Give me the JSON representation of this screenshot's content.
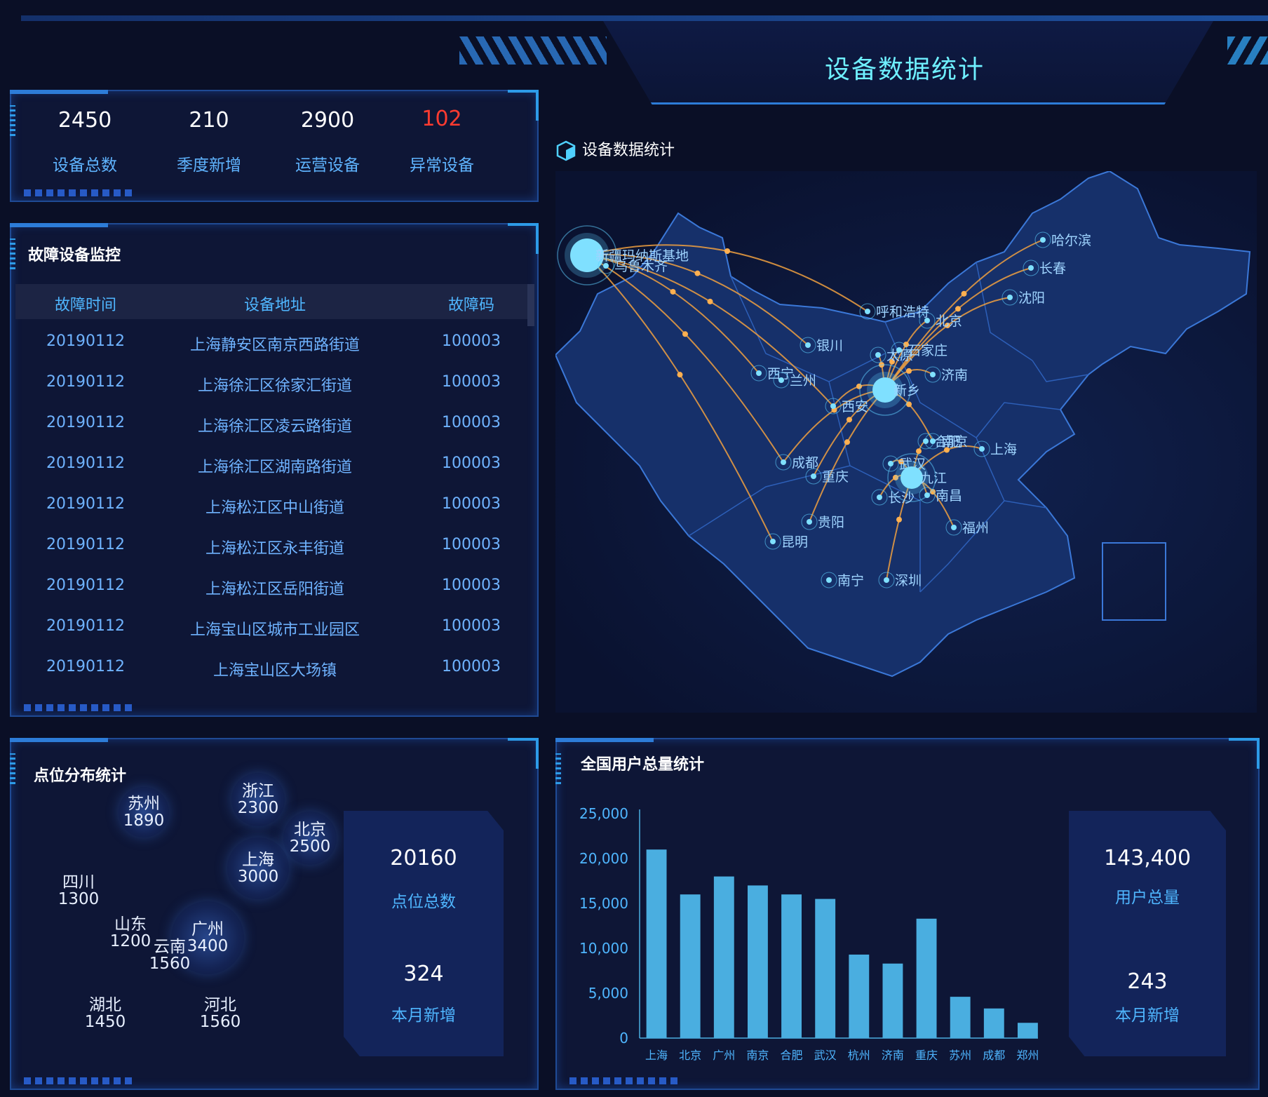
{
  "header": {
    "title": "设备数据统计"
  },
  "stats": [
    {
      "value": "2450",
      "label": "设备总数",
      "color": "#ffffff"
    },
    {
      "value": "210",
      "label": "季度新增",
      "color": "#ffffff"
    },
    {
      "value": "2900",
      "label": "运营设备",
      "color": "#ffffff"
    },
    {
      "value": "102",
      "label": "异常设备",
      "color": "#ff3b30"
    }
  ],
  "fault_monitor": {
    "title": "故障设备监控",
    "columns": [
      "故障时间",
      "设备地址",
      "故障码"
    ],
    "rows": [
      [
        "20190112",
        "上海静安区南京西路街道",
        "100003"
      ],
      [
        "20190112",
        "上海徐汇区徐家汇街道",
        "100003"
      ],
      [
        "20190112",
        "上海徐汇区凌云路街道",
        "100003"
      ],
      [
        "20190112",
        "上海徐汇区湖南路街道",
        "100003"
      ],
      [
        "20190112",
        "上海松江区中山街道",
        "100003"
      ],
      [
        "20190112",
        "上海松江区永丰街道",
        "100003"
      ],
      [
        "20190112",
        "上海松江区岳阳街道",
        "100003"
      ],
      [
        "20190112",
        "上海宝山区城市工业园区",
        "100003"
      ],
      [
        "20190112",
        "上海宝山区大场镇",
        "100003"
      ]
    ]
  },
  "map_section": {
    "title": "设备数据统计",
    "cities": [
      "新疆玛纳斯基地",
      "乌鲁木齐",
      "哈尔滨",
      "长春",
      "沈阳",
      "呼和浩特",
      "北京",
      "银川",
      "石家庄",
      "太原",
      "济南",
      "西宁",
      "兰州",
      "新乡",
      "西安",
      "南京",
      "上海",
      "合肥",
      "成都",
      "武汉",
      "九江",
      "重庆",
      "长沙",
      "南昌",
      "福州",
      "贵阳",
      "昆明",
      "南宁",
      "深圳"
    ]
  },
  "distribution": {
    "title": "点位分布统计",
    "bubbles": [
      {
        "name": "苏州",
        "value": "1890"
      },
      {
        "name": "浙江",
        "value": "2300"
      },
      {
        "name": "北京",
        "value": "2500"
      },
      {
        "name": "四川",
        "value": "1300"
      },
      {
        "name": "上海",
        "value": "3000"
      },
      {
        "name": "山东",
        "value": "1200"
      },
      {
        "name": "广州",
        "value": "3400"
      },
      {
        "name": "云南",
        "value": "1560"
      },
      {
        "name": "湖北",
        "value": "1450"
      },
      {
        "name": "河北",
        "value": "1560"
      }
    ],
    "total_value": "20160",
    "total_label": "点位总数",
    "new_value": "324",
    "new_label": "本月新增"
  },
  "users": {
    "title": "全国用户总量统计",
    "total_value": "143,400",
    "total_label": "用户总量",
    "new_value": "243",
    "new_label": "本月新增"
  },
  "chart_data": {
    "type": "bar",
    "categories": [
      "上海",
      "北京",
      "广州",
      "南京",
      "合肥",
      "武汉",
      "杭州",
      "济南",
      "重庆",
      "苏州",
      "成都",
      "郑州"
    ],
    "values": [
      21000,
      16000,
      18000,
      17000,
      16000,
      15500,
      9300,
      8300,
      13300,
      4600,
      3300,
      1700
    ],
    "ylim": [
      0,
      25000
    ],
    "yticks": [
      "0",
      "5,000",
      "10,000",
      "15,000",
      "20,000",
      "25,000"
    ],
    "bar_color": "#4aaee0"
  }
}
